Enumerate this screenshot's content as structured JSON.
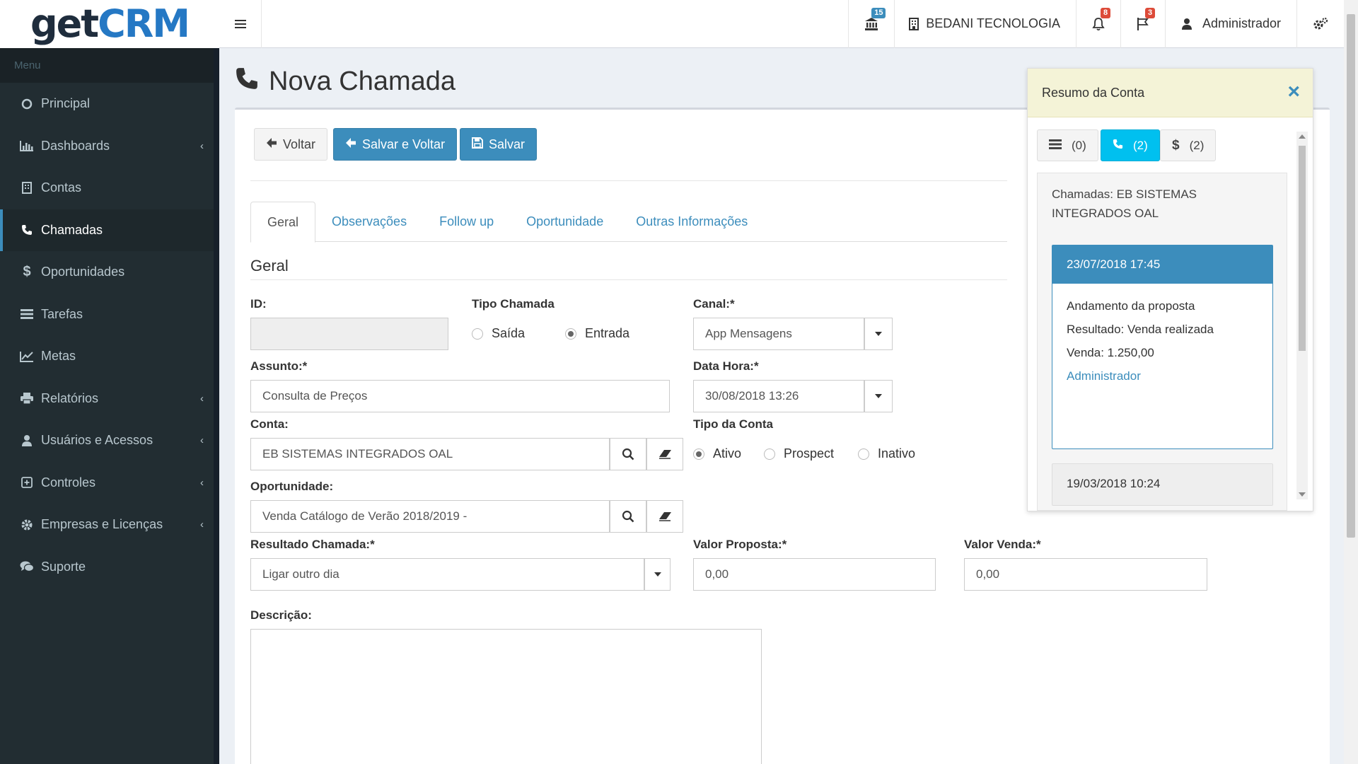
{
  "header": {
    "logo_get": "get",
    "logo_crm": "CRM",
    "bank_badge": "15",
    "company": "BEDANI TECNOLOGIA",
    "notifications_badge": "8",
    "flags_badge": "3",
    "user": "Administrador"
  },
  "sidebar": {
    "header": "Menu",
    "items": [
      {
        "label": "Principal",
        "icon": "circle-icon"
      },
      {
        "label": "Dashboards",
        "icon": "bar-chart-icon"
      },
      {
        "label": "Contas",
        "icon": "building-icon"
      },
      {
        "label": "Chamadas",
        "icon": "phone-icon"
      },
      {
        "label": "Oportunidades",
        "icon": "dollar-icon"
      },
      {
        "label": "Tarefas",
        "icon": "list-icon"
      },
      {
        "label": "Metas",
        "icon": "line-chart-icon"
      },
      {
        "label": "Relatórios",
        "icon": "print-icon"
      },
      {
        "label": "Usuários e Acessos",
        "icon": "user-icon"
      },
      {
        "label": "Controles",
        "icon": "plus-square-icon"
      },
      {
        "label": "Empresas e Licenças",
        "icon": "cog-icon"
      },
      {
        "label": "Suporte",
        "icon": "comments-icon"
      }
    ]
  },
  "page": {
    "title": "Nova Chamada"
  },
  "toolbar": {
    "back": "Voltar",
    "save_back": "Salvar e Voltar",
    "save": "Salvar"
  },
  "tabs": [
    "Geral",
    "Observações",
    "Follow up",
    "Oportunidade",
    "Outras Informações"
  ],
  "form": {
    "section_title": "Geral",
    "id_label": "ID:",
    "id_value": "",
    "tipo_chamada_label": "Tipo Chamada",
    "tipo_saida": "Saída",
    "tipo_entrada": "Entrada",
    "canal_label": "Canal:*",
    "canal_value": "App Mensagens",
    "assunto_label": "Assunto:*",
    "assunto_value": "Consulta de Preços",
    "data_hora_label": "Data Hora:*",
    "data_hora_value": "30/08/2018 13:26",
    "conta_label": "Conta:",
    "conta_value": "EB SISTEMAS INTEGRADOS OAL",
    "tipo_conta_label": "Tipo da Conta",
    "tipo_ativo": "Ativo",
    "tipo_prospect": "Prospect",
    "tipo_inativo": "Inativo",
    "oportunidade_label": "Oportunidade:",
    "oportunidade_value": "Venda Catálogo de Verão 2018/2019 -",
    "resultado_label": "Resultado Chamada:*",
    "resultado_value": "Ligar outro dia",
    "valor_proposta_label": "Valor Proposta:*",
    "valor_proposta_value": "0,00",
    "valor_venda_label": "Valor Venda:*",
    "valor_venda_value": "0,00",
    "descricao_label": "Descrição:"
  },
  "summary": {
    "title": "Resumo da Conta",
    "close": "×",
    "btn_list_count": "(0)",
    "btn_calls_count": "(2)",
    "btn_dollar_count": "(2)",
    "card_title": "Chamadas: EB SISTEMAS INTEGRADOS OAL",
    "entries": [
      {
        "datetime": "23/07/2018 17:45",
        "subject": "Andamento da proposta",
        "result": "Resultado: Venda realizada",
        "sale": "Venda: 1.250,00",
        "user": "Administrador"
      },
      {
        "datetime": "19/03/2018 10:24"
      }
    ]
  }
}
